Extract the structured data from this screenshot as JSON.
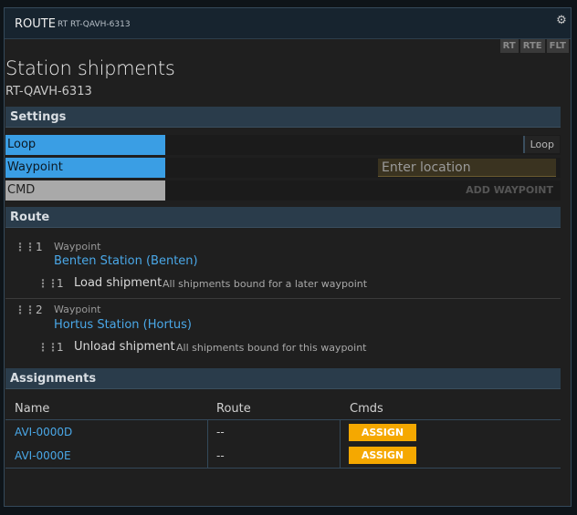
{
  "window": {
    "title": "ROUTE",
    "subtitle": "RT RT-QAVH-6313"
  },
  "tabs": [
    "RT",
    "RTE",
    "FLT"
  ],
  "page": {
    "title": "Station shipments",
    "subtitle": "RT-QAVH-6313"
  },
  "settings": {
    "header": "Settings",
    "loop_label": "Loop",
    "loop_button": "Loop",
    "waypoint_label": "Waypoint",
    "location_placeholder": "Enter location",
    "cmd_label": "CMD",
    "add_waypoint": "ADD WAYPOINT"
  },
  "route": {
    "header": "Route",
    "waypoints": [
      {
        "num": "1",
        "type": "Waypoint",
        "station": "Benten Station (Benten)",
        "cmd_num": "1",
        "cmd_name": "Load shipment",
        "cmd_desc": "All shipments bound for a later waypoint"
      },
      {
        "num": "2",
        "type": "Waypoint",
        "station": "Hortus Station (Hortus)",
        "cmd_num": "1",
        "cmd_name": "Unload shipment",
        "cmd_desc": "All shipments bound for this waypoint"
      }
    ]
  },
  "assignments": {
    "header": "Assignments",
    "columns": [
      "Name",
      "Route",
      "Cmds"
    ],
    "rows": [
      {
        "name": "AVI-0000D",
        "route": "--",
        "action": "ASSIGN"
      },
      {
        "name": "AVI-0000E",
        "route": "--",
        "action": "ASSIGN"
      }
    ]
  },
  "colors": {
    "accent_blue": "#3a9ee4",
    "link_blue": "#4aa8e8",
    "assign_orange": "#f5a800",
    "header_bg": "#2a3c4b"
  },
  "icons": {
    "settings": "gear-icon",
    "drag_handle": "drag-handle-icon"
  }
}
